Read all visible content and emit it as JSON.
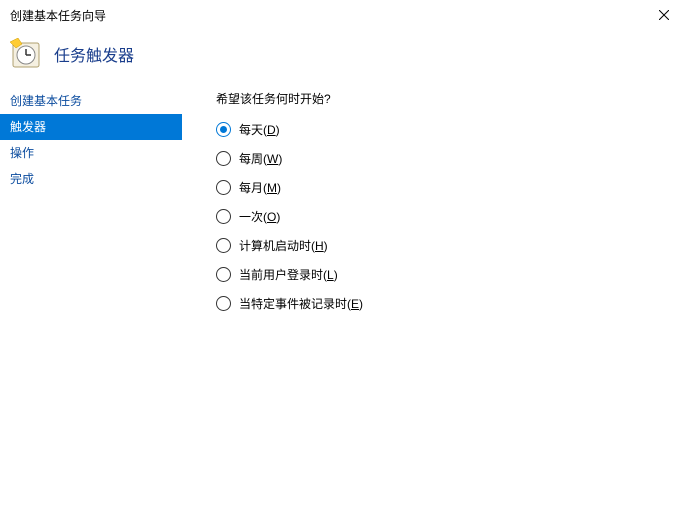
{
  "window": {
    "title": "创建基本任务向导"
  },
  "header": {
    "title": "任务触发器"
  },
  "sidebar": {
    "items": [
      {
        "label": "创建基本任务",
        "selected": false
      },
      {
        "label": "触发器",
        "selected": true
      },
      {
        "label": "操作",
        "selected": false
      },
      {
        "label": "完成",
        "selected": false
      }
    ]
  },
  "content": {
    "question": "希望该任务何时开始?",
    "options": [
      {
        "label": "每天",
        "accel": "D",
        "checked": true
      },
      {
        "label": "每周",
        "accel": "W",
        "checked": false
      },
      {
        "label": "每月",
        "accel": "M",
        "checked": false
      },
      {
        "label": "一次",
        "accel": "O",
        "checked": false
      },
      {
        "label": "计算机启动时",
        "accel": "H",
        "checked": false
      },
      {
        "label": "当前用户登录时",
        "accel": "L",
        "checked": false
      },
      {
        "label": "当特定事件被记录时",
        "accel": "E",
        "checked": false
      }
    ]
  }
}
